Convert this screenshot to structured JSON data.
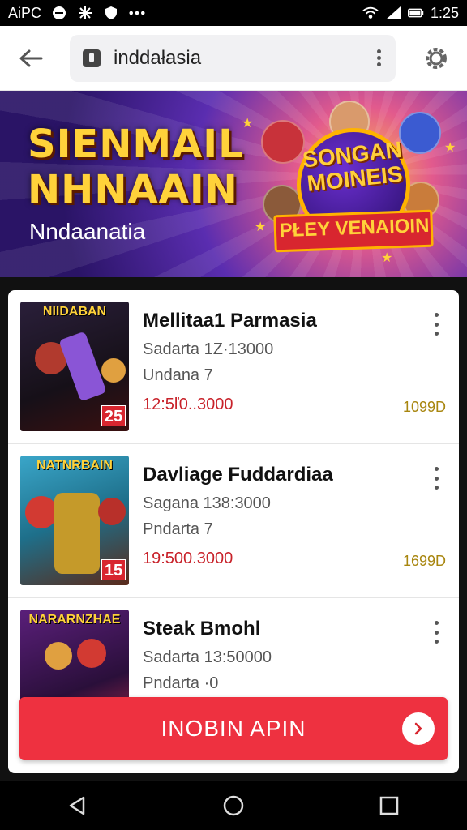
{
  "status_bar": {
    "left_text": "AiPC",
    "time": "1:25",
    "icons": [
      "no-entry-icon",
      "settings-flower-icon",
      "shield-icon",
      "more-dots-icon",
      "wifi-icon",
      "signal-icon",
      "battery-icon"
    ]
  },
  "browser": {
    "url": "inddałasia",
    "icons": [
      "back-arrow-icon",
      "lock-icon",
      "menu-dots-icon",
      "settings-gear-icon"
    ]
  },
  "banner": {
    "title_line1": "SIENMAIL",
    "title_line2": "NHNAAIN",
    "subtitle": "Nndaanatia",
    "badge_line1": "SONGAN",
    "badge_line2": "MOINEIS",
    "ribbon": "PŁEY VENAIOIN"
  },
  "items": [
    {
      "thumb_title": "NIIDABAN",
      "thumb_number": "25",
      "thumb_color": "#1b1a2a",
      "title": "Mellitaa1 Parmasia",
      "line1": "Sadarta 1Z·13000",
      "line2": "Undana 7",
      "price": "12:5ľ0..3000",
      "count": "1099D"
    },
    {
      "thumb_title": "NATNRBAIN",
      "thumb_number": "15",
      "thumb_color": "#1e6f8a",
      "title": "Davliage Fuddardiaa",
      "line1": "Sagana 138:3000",
      "line2": "Pndarta 7",
      "price": "19:500.3000",
      "count": "1699D"
    },
    {
      "thumb_title": "NARARNZHAE",
      "thumb_number": "",
      "thumb_color": "#3a1a5a",
      "title": "Steak Bmohl",
      "line1": "Sadarta 13:50000",
      "line2": "Pndarta ·0",
      "price": "",
      "count": ""
    }
  ],
  "cta": {
    "label": "INOBIN APIN",
    "icon": "chevron-right-icon"
  },
  "nav": {
    "icons": [
      "back-triangle-icon",
      "home-circle-icon",
      "recents-square-icon"
    ]
  },
  "colors": {
    "accent_red": "#ee3140",
    "price_red": "#c8222a",
    "count_gold": "#a8860f",
    "banner_title": "#ffd23a"
  }
}
